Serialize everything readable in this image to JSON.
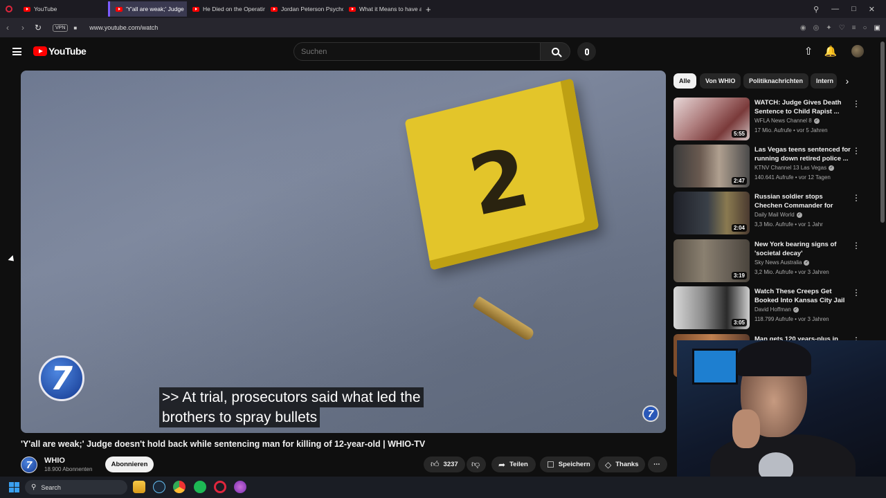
{
  "browser": {
    "tabs": [
      {
        "label": "YouTube",
        "active": false
      },
      {
        "label": "'Y'all are weak;' Judge",
        "active": true
      },
      {
        "label": "He Died on the Operating",
        "active": false
      },
      {
        "label": "Jordan Peterson Psychoan",
        "active": false
      },
      {
        "label": "What it Means to have an",
        "active": false
      }
    ],
    "new_tab": "+",
    "vpn": "VPN",
    "url": "www.youtube.com/watch"
  },
  "header": {
    "logo_text": "YouTube",
    "search_placeholder": "Suchen"
  },
  "player": {
    "marker_number": "2",
    "channel_logo": "7",
    "caption_line1": ">> At trial, prosecutors said what led the",
    "caption_line2": "brothers to spray bullets"
  },
  "video": {
    "title": "'Y'all are weak;' Judge doesn't hold back while sentencing man for killing of 12-year-old | WHIO-TV",
    "channel": "WHIO",
    "subscribers": "18.900 Abonnenten",
    "subscribe_label": "Abonnieren",
    "likes": "3237",
    "share_label": "Teilen",
    "save_label": "Speichern",
    "thanks_label": "Thanks",
    "more": "⋯"
  },
  "chips": [
    "Alle",
    "Von WHIO",
    "Politiknachrichten",
    "Intern"
  ],
  "recommendations": [
    {
      "title": "WATCH: Judge Gives Death Sentence to Child Rapist ...",
      "channel": "WFLA News Channel 8",
      "meta": "17 Mio. Aufrufe • vor 5 Jahren",
      "duration": "5:55"
    },
    {
      "title": "Las Vegas teens sentenced for running down retired police ...",
      "channel": "KTNV Channel 13 Las Vegas",
      "meta": "140.641 Aufrufe • vor 12 Tagen",
      "duration": "2:47"
    },
    {
      "title": "Russian soldier stops Chechen Commander for documentatio...",
      "channel": "Daily Mail World",
      "meta": "3,3 Mio. Aufrufe • vor 1 Jahr",
      "duration": "2:04"
    },
    {
      "title": "New York bearing signs of 'societal decay'",
      "channel": "Sky News Australia",
      "meta": "3,2 Mio. Aufrufe • vor 3 Jahren",
      "duration": "3:19"
    },
    {
      "title": "Watch These Creeps Get Booked Into Kansas City Jail I...",
      "channel": "David Hoffman",
      "meta": "118.799 Aufrufe • vor 3 Jahren",
      "duration": "3:05"
    },
    {
      "title": "Man gets 120 years-plus in",
      "channel": "",
      "meta": "",
      "duration": ""
    }
  ],
  "taskbar": {
    "search_label": "Search"
  },
  "colors": {
    "accent_red": "#ff0000",
    "background": "#0f0f0f",
    "marker_yellow": "#e3c52a"
  },
  "icons": [
    "hamburger-icon",
    "search-icon",
    "mic-icon",
    "upload-icon",
    "bell-icon",
    "like-icon",
    "dislike-icon",
    "share-icon",
    "save-icon",
    "thanks-icon",
    "kebab-icon",
    "chevron-right-icon",
    "windows-icon"
  ]
}
